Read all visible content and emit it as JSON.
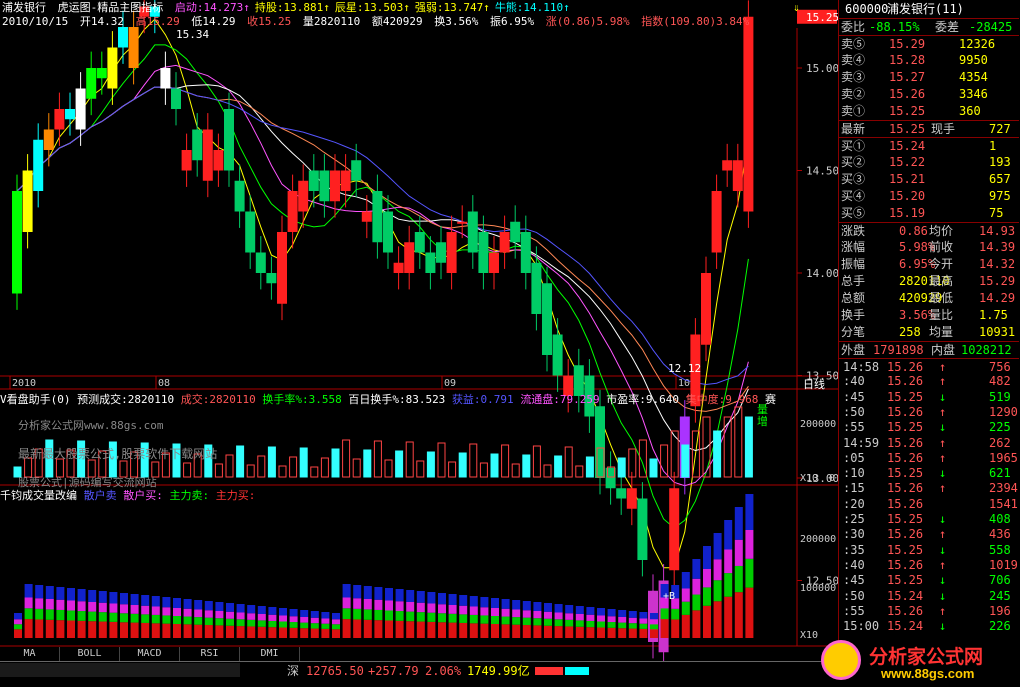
{
  "stock": {
    "name": "浦发银行",
    "indicator": "虎运图-精品主图指标",
    "date": "2010/10/15"
  },
  "signals": [
    {
      "label": "启动:",
      "value": "14.273",
      "color": "#ff55ff",
      "arrow": "↑"
    },
    {
      "label": "持股:",
      "value": "13.881",
      "color": "#ffff00",
      "arrow": "↑"
    },
    {
      "label": "辰星:",
      "value": "13.503",
      "color": "#ffff00",
      "arrow": "↑"
    },
    {
      "label": "强弱:",
      "value": "13.747",
      "color": "#ffff00",
      "arrow": "↑"
    },
    {
      "label": "牛熊:",
      "value": "14.110",
      "color": "#00ffff",
      "arrow": "↑"
    }
  ],
  "ohlc": {
    "open": "开14.32",
    "high": "高15.29",
    "low": "低14.29",
    "close": "收15.25",
    "vol": "量2820110",
    "amount": "额420929",
    "turnover": "换3.56%",
    "amplitude": "振6.95%",
    "change": "涨(0.86)5.98%",
    "index": "指数(109.80)3.84%"
  },
  "price_axis": [
    "15.25",
    "15.00",
    "14.50",
    "14.00",
    "13.50",
    "13.00",
    "12.50"
  ],
  "chart_labels": {
    "high_marker": "15.34",
    "low_marker": "12.12",
    "period": "日线"
  },
  "time_axis": [
    "2010",
    "08",
    "09",
    "10"
  ],
  "vol_panel": {
    "title": "V看盘助手(0)",
    "predict": "预测成交:2820110",
    "deal": "成交:2820110",
    "turnover_pct": "换手率%:3.558",
    "hundred_turnover": "百日换手%:83.523",
    "profit": "获益:0.791",
    "float": "流通盘:79.259",
    "pb": "市盈率:9.640",
    "concentration": "集中度:9.968",
    "mark": "赛",
    "axis_top": "200000",
    "axis_unit": "X10",
    "axis_zero": "0",
    "note1": "分析家公式网www.88gs.com",
    "note2": "最新最大股票公式,股票软件下载网站",
    "note3": "股票公式|源码编写交流网站",
    "vol_tag": "量增"
  },
  "lot_panel": {
    "title": "千钧成交量改编",
    "retail_sell": "散户卖",
    "retail_buy": "散户买:",
    "main_sell": "主力卖:",
    "main_buy": "主力买:",
    "axis": [
      "200000",
      "100000"
    ],
    "axis_unit": "X10",
    "tag": "+B"
  },
  "tabs": [
    "MA",
    "BOLL",
    "MACD",
    "RSI",
    "DMI"
  ],
  "status": {
    "market": "深",
    "index": "12765.50",
    "change": "+257.79",
    "pct": "2.06%",
    "amount": "1749.99亿"
  },
  "quote": {
    "code": "600000",
    "name": "浦发银行(11)",
    "wei_bi": "委比",
    "wei_bi_val": "-88.15%",
    "wei_cha": "委差",
    "wei_cha_val": "-28425",
    "asks": [
      [
        "卖⑤",
        "15.29",
        "12326"
      ],
      [
        "卖④",
        "15.28",
        "9950"
      ],
      [
        "卖③",
        "15.27",
        "4354"
      ],
      [
        "卖②",
        "15.26",
        "3346"
      ],
      [
        "卖①",
        "15.25",
        "360"
      ]
    ],
    "last_label": "最新",
    "last": "15.25",
    "vol_label": "现手",
    "vol": "727",
    "bids": [
      [
        "买①",
        "15.24",
        "1"
      ],
      [
        "买②",
        "15.22",
        "193"
      ],
      [
        "买③",
        "15.21",
        "657"
      ],
      [
        "买④",
        "15.20",
        "975"
      ],
      [
        "买⑤",
        "15.19",
        "75"
      ]
    ],
    "stats": [
      [
        "涨跌",
        "0.86",
        "均价",
        "14.93"
      ],
      [
        "涨幅",
        "5.98%",
        "前收",
        "14.39"
      ],
      [
        "振幅",
        "6.95%",
        "今开",
        "14.32"
      ],
      [
        "总手",
        "2820110",
        "最高",
        "15.29"
      ],
      [
        "总额",
        "420929",
        "最低",
        "14.29"
      ],
      [
        "换手",
        "3.56%",
        "量比",
        "1.75"
      ],
      [
        "分笔",
        "258",
        "均量",
        "10931"
      ]
    ],
    "outer": "外盘",
    "outer_val": "1791898",
    "inner": "内盘",
    "inner_val": "1028212",
    "ticks": [
      [
        "14:58",
        "15.26",
        "↑",
        "756"
      ],
      [
        ":40",
        "15.26",
        "↑",
        "482"
      ],
      [
        ":45",
        "15.25",
        "↓",
        "519"
      ],
      [
        ":50",
        "15.26",
        "↑",
        "1290"
      ],
      [
        ":55",
        "15.25",
        "↓",
        "225"
      ],
      [
        "14:59",
        "15.26",
        "↑",
        "262"
      ],
      [
        ":05",
        "15.26",
        "↑",
        "1965"
      ],
      [
        ":10",
        "15.25",
        "↓",
        "621"
      ],
      [
        ":15",
        "15.26",
        "↑",
        "2394"
      ],
      [
        ":20",
        "15.26",
        "",
        "1541"
      ],
      [
        ":25",
        "15.25",
        "↓",
        "408"
      ],
      [
        ":30",
        "15.26",
        "↑",
        "436"
      ],
      [
        ":35",
        "15.25",
        "↓",
        "558"
      ],
      [
        ":40",
        "15.26",
        "↑",
        "1019"
      ],
      [
        ":45",
        "15.25",
        "↓",
        "706"
      ],
      [
        ":50",
        "15.24",
        "↓",
        "245"
      ],
      [
        ":55",
        "15.26",
        "↑",
        "196"
      ],
      [
        "15:00",
        "15.24",
        "↓",
        "226"
      ]
    ]
  },
  "brand": {
    "logo": "分析家公式网",
    "url": "www.88gs.com"
  }
}
